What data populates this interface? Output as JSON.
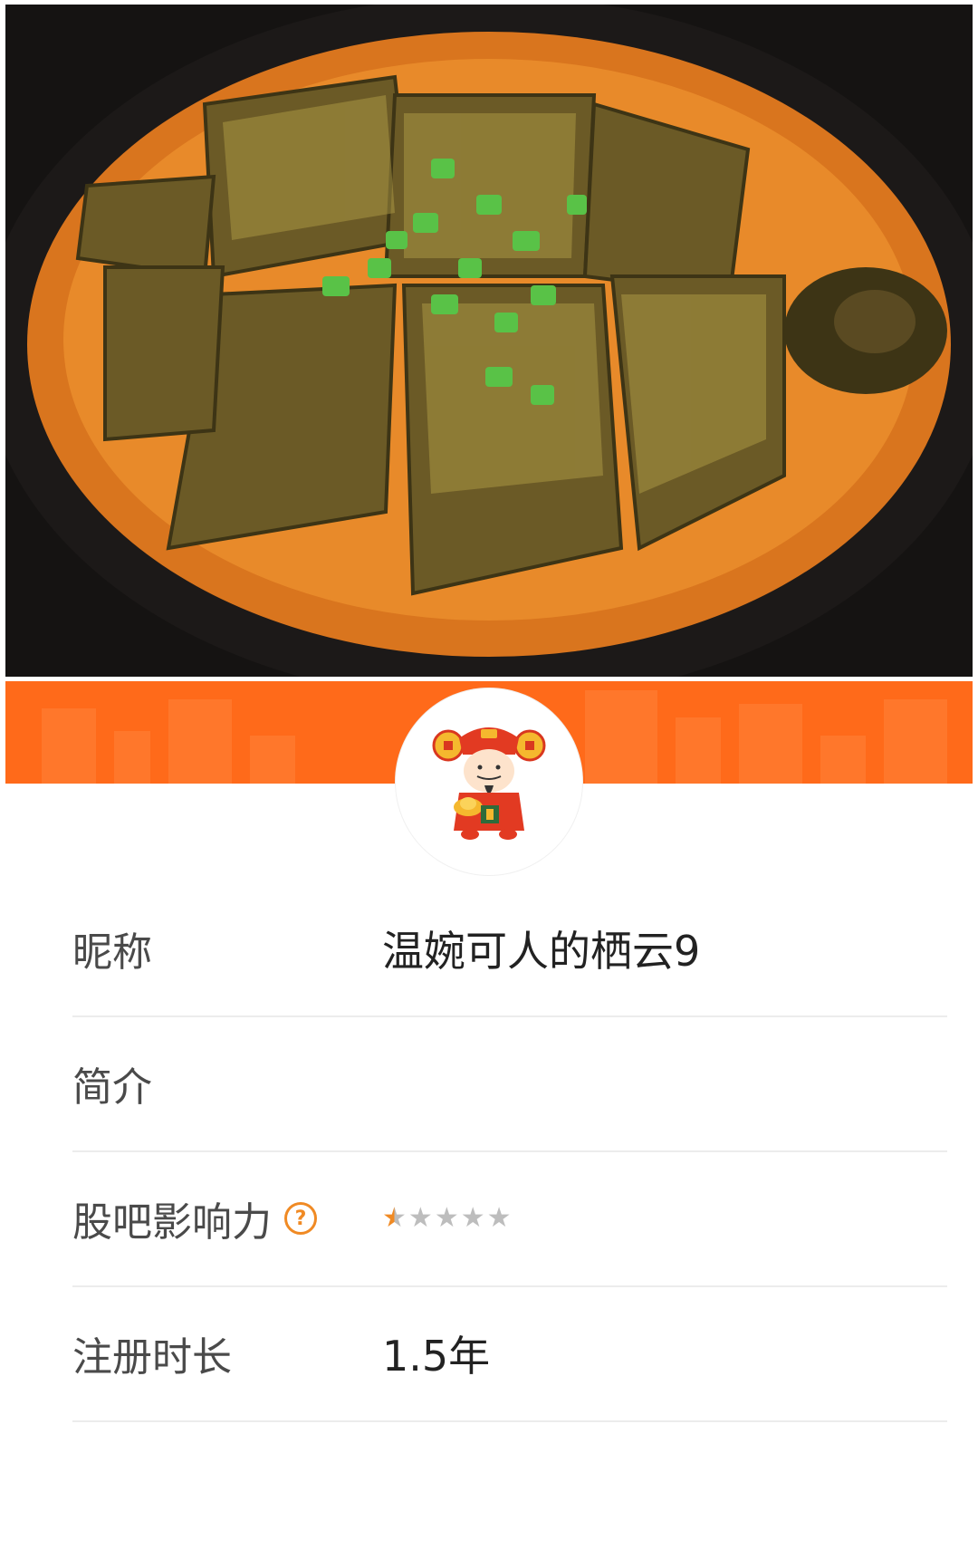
{
  "profile": {
    "rows": [
      {
        "label": "昵称",
        "value": "温婉可人的栖云9"
      },
      {
        "label": "简介",
        "value": ""
      },
      {
        "label": "股吧影响力",
        "help_icon": "question-circle-icon",
        "rating": 0.5,
        "rating_max": 5
      },
      {
        "label": "注册时长",
        "value": "1.5年"
      }
    ]
  },
  "colors": {
    "accent": "#ff6a1a",
    "star_active": "#f08a24",
    "star_inactive": "#bdbdbd"
  }
}
